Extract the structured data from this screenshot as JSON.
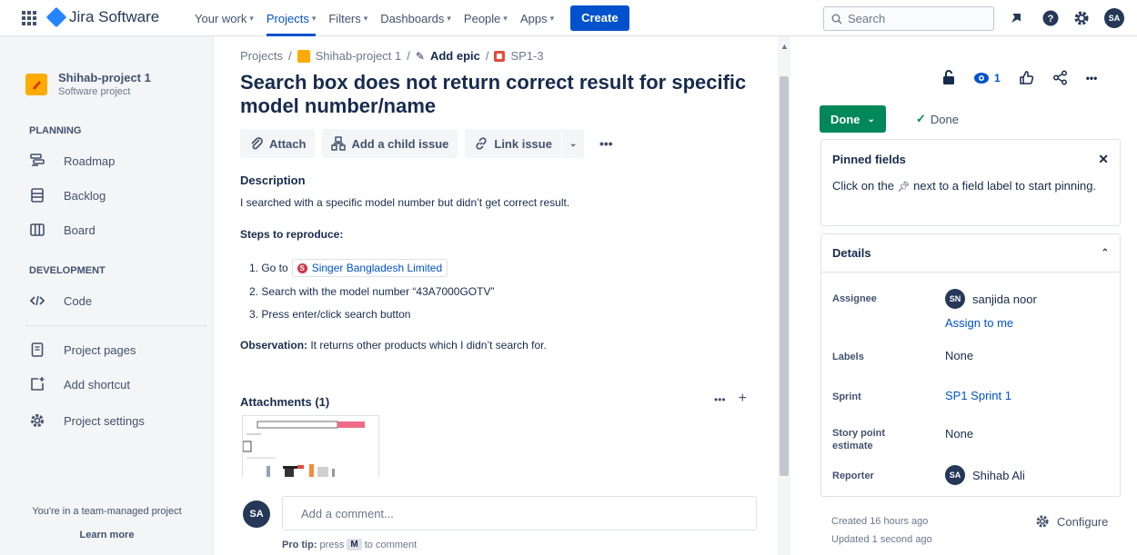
{
  "topnav": {
    "product": "Jira Software",
    "items": [
      {
        "label": "Your work",
        "active": false
      },
      {
        "label": "Projects",
        "active": true
      },
      {
        "label": "Filters",
        "active": false
      },
      {
        "label": "Dashboards",
        "active": false
      },
      {
        "label": "People",
        "active": false
      },
      {
        "label": "Apps",
        "active": false
      }
    ],
    "create_label": "Create",
    "search_placeholder": "Search",
    "user_initials": "SA"
  },
  "sidebar": {
    "project_name": "Shihab-project 1",
    "project_type": "Software project",
    "planning_title": "PLANNING",
    "planning_items": [
      "Roadmap",
      "Backlog",
      "Board"
    ],
    "development_title": "DEVELOPMENT",
    "development_items": [
      "Code"
    ],
    "other_items": [
      "Project pages",
      "Add shortcut",
      "Project settings"
    ],
    "footer_text": "You're in a team-managed project",
    "footer_link": "Learn more"
  },
  "issue": {
    "breadcrumb": {
      "root": "Projects",
      "project": "Shihab-project 1",
      "epic": "Add epic",
      "key": "SP1-3"
    },
    "title": "Search box does not return correct result for specific model number/name",
    "actions": {
      "attach": "Attach",
      "child": "Add a child issue",
      "link": "Link issue"
    },
    "description_label": "Description",
    "description": "I searched with a specific model number but didn’t get correct result.",
    "steps_heading": "Steps to reproduce:",
    "step1_prefix": "1. Go to",
    "step1_link": "Singer Bangladesh Limited",
    "step2": "2. Search with the model number “43A7000GOTV”",
    "step3": "3. Press enter/click search button",
    "observation_label": "Observation:",
    "observation_text": " It returns other products which I didn’t search for.",
    "attachments_heading": "Attachments (1)",
    "comment_initials": "SA",
    "comment_placeholder": "Add a comment...",
    "protip_label": "Pro tip:",
    "protip_pre": "press",
    "protip_key": "M",
    "protip_post": "to comment"
  },
  "right": {
    "watchers_count": "1",
    "status_label": "Done",
    "resolution": "Done",
    "pinned_title": "Pinned fields",
    "pinned_pre": "Click on the",
    "pinned_post": "next to a field label to start pinning.",
    "details_title": "Details",
    "assignee_label": "Assignee",
    "assignee_initials": "SN",
    "assignee_name": "sanjida noor",
    "assign_to_me": "Assign to me",
    "labels_label": "Labels",
    "labels_value": "None",
    "sprint_label": "Sprint",
    "sprint_value": "SP1 Sprint 1",
    "story_label": "Story point estimate",
    "story_value": "None",
    "reporter_label": "Reporter",
    "reporter_initials": "SA",
    "reporter_name": "Shihab Ali",
    "created": "Created 16 hours ago",
    "updated": "Updated 1 second ago",
    "configure": "Configure"
  },
  "colors": {
    "accent": "#0052cc",
    "done_green": "#00875a",
    "project_icon": "#ffab00"
  }
}
